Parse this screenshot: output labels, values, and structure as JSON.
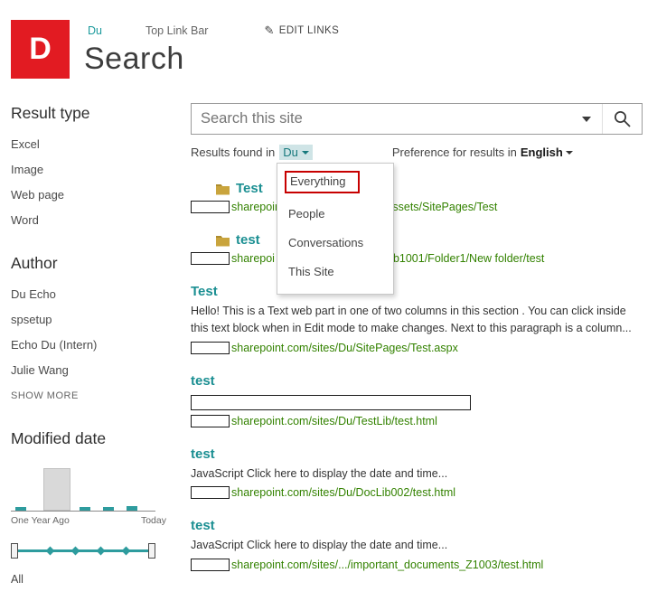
{
  "header": {
    "logo_letter": "D",
    "nav": {
      "site": "Du",
      "top_link_bar": "Top Link Bar",
      "edit_links": "EDIT LINKS"
    },
    "page_title": "Search"
  },
  "search_box": {
    "placeholder": "Search this site"
  },
  "scope_bar": {
    "results_found_label": "Results found in",
    "scope_value": "Du",
    "preference_label": "Preference for results in",
    "preference_value": "English"
  },
  "scope_menu": {
    "items": [
      {
        "label": "Everything",
        "highlighted": true
      },
      {
        "label": "People",
        "highlighted": false
      },
      {
        "label": "Conversations",
        "highlighted": false
      },
      {
        "label": "This Site",
        "highlighted": false
      }
    ],
    "highlight_color": "#c70000"
  },
  "sidebar": {
    "result_type": {
      "title": "Result type",
      "items": [
        "Excel",
        "Image",
        "Web page",
        "Word"
      ]
    },
    "author": {
      "title": "Author",
      "items": [
        "Du Echo",
        "spsetup",
        "Echo Du (Intern)",
        "Julie Wang"
      ],
      "show_more": "SHOW MORE"
    },
    "modified_date": {
      "title": "Modified date",
      "left_label": "One Year Ago",
      "right_label": "Today",
      "all_label": "All",
      "histogram_relative_heights": [
        4,
        47,
        4,
        4,
        5
      ]
    }
  },
  "results": [
    {
      "title": "Test",
      "type": "folder",
      "snippet": "",
      "url_prefix": "sharepoint",
      "url_suffix": "ssets/SitePages/Test"
    },
    {
      "title": "test",
      "type": "folder",
      "snippet": "",
      "url_prefix": "sharepoi",
      "url_suffix": "b1001/Folder1/New folder/test"
    },
    {
      "title": "Test",
      "type": "page",
      "snippet": "Hello! This is a Text web part in one of two columns in this section . You can click inside this text block when in Edit mode to make changes. Next to this paragraph is a column...",
      "url_prefix": "sharepoint.com/sites/Du/SitePages/Test.aspx",
      "url_suffix": ""
    },
    {
      "title": "test",
      "type": "page",
      "snippet": "",
      "url_prefix": "sharepoint.com/sites/Du/TestLib/test.html",
      "url_suffix": ""
    },
    {
      "title": "test",
      "type": "page",
      "snippet": "JavaScript Click here to display the date and time...",
      "url_prefix": "sharepoint.com/sites/Du/DocLib002/test.html",
      "url_suffix": ""
    },
    {
      "title": "test",
      "type": "page",
      "snippet": "JavaScript Click here to display the date and time...",
      "url_prefix": "sharepoint.com/sites/.../important_documents_Z1003/test.html",
      "url_suffix": ""
    }
  ],
  "colors": {
    "brand_red": "#e21b22",
    "link_teal": "#1b8f92",
    "url_green": "#338200",
    "slider_teal": "#2e9c9e"
  }
}
